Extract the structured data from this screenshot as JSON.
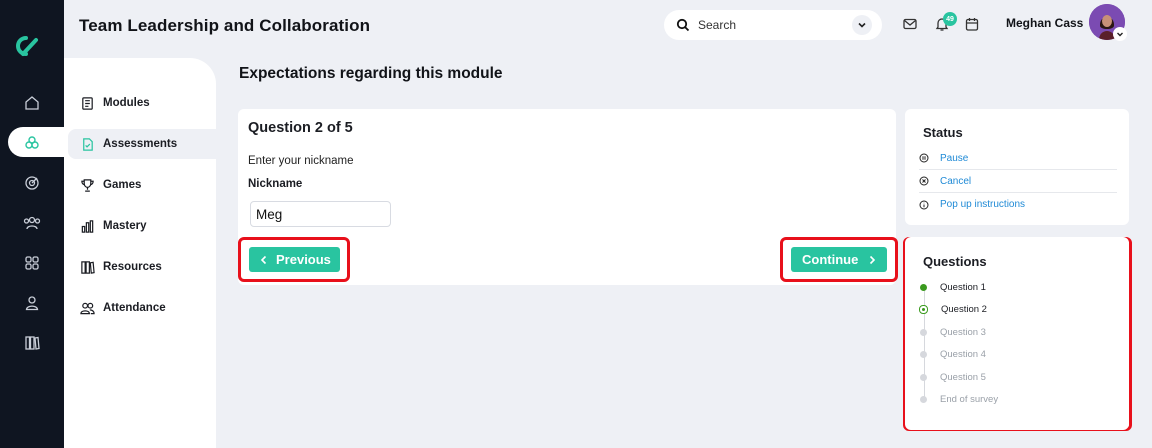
{
  "app": {
    "title": "Team Leadership and Collaboration"
  },
  "header": {
    "search_placeholder": "Search",
    "notification_count": "49",
    "user_name": "Meghan Cass"
  },
  "rail": {
    "items": [
      "home-icon",
      "assessments-icon",
      "target-icon",
      "team-icon",
      "apps-icon",
      "user-icon",
      "library-icon"
    ],
    "active": "assessments-icon"
  },
  "sidebar": {
    "items": [
      {
        "label": "Modules",
        "icon": "modules-icon"
      },
      {
        "label": "Assessments",
        "icon": "assessment-icon"
      },
      {
        "label": "Games",
        "icon": "trophy-icon"
      },
      {
        "label": "Mastery",
        "icon": "bar-chart-icon"
      },
      {
        "label": "Resources",
        "icon": "books-icon"
      },
      {
        "label": "Attendance",
        "icon": "people-icon"
      }
    ],
    "active": "Assessments"
  },
  "main": {
    "title": "Expectations regarding this module",
    "question": {
      "heading": "Question 2 of 5",
      "prompt": "Enter your nickname",
      "field_label": "Nickname",
      "field_value": "Meg"
    },
    "buttons": {
      "previous": "Previous",
      "continue": "Continue"
    }
  },
  "status": {
    "title": "Status",
    "actions": [
      {
        "label": "Pause",
        "icon": "pause-icon"
      },
      {
        "label": "Cancel",
        "icon": "cancel-icon"
      },
      {
        "label": "Pop up instructions",
        "icon": "info-icon"
      }
    ]
  },
  "questions": {
    "title": "Questions",
    "items": [
      {
        "label": "Question 1",
        "state": "done"
      },
      {
        "label": "Question 2",
        "state": "current"
      },
      {
        "label": "Question 3",
        "state": "pending"
      },
      {
        "label": "Question 4",
        "state": "pending"
      },
      {
        "label": "Question 5",
        "state": "pending"
      },
      {
        "label": "End of survey",
        "state": "pending"
      }
    ]
  },
  "colors": {
    "accent": "#29c4a0",
    "rail": "#0f1521",
    "highlight": "#e8101b",
    "link": "#1f8ad6",
    "progress": "#3a9a1e"
  }
}
